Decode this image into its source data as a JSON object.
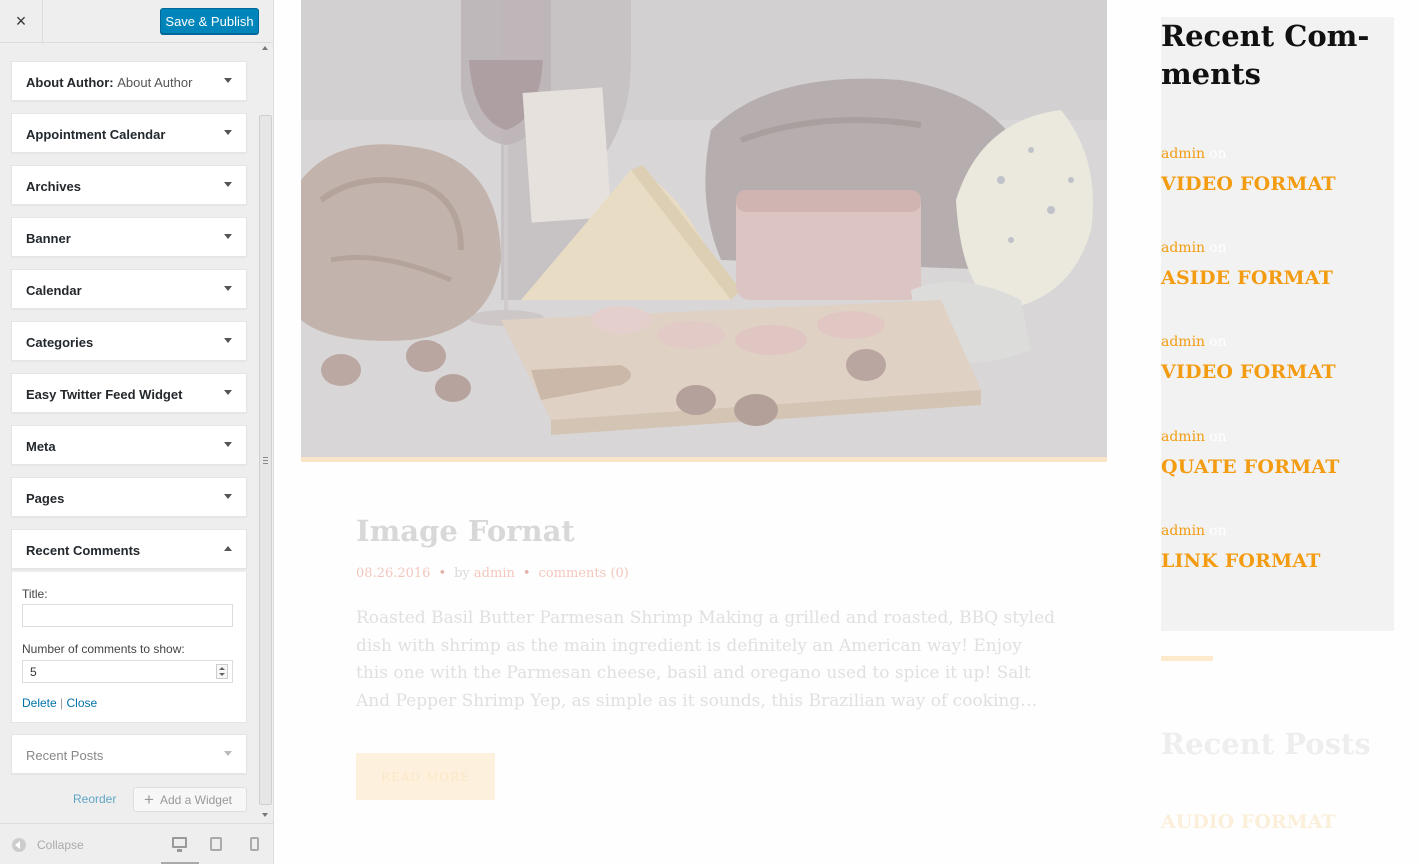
{
  "customizer": {
    "close_icon": "×",
    "save_publish": "Save & Publish",
    "widgets": [
      {
        "label": "About Author:",
        "sublabel": "About Author",
        "expanded": false
      },
      {
        "label": "Appointment Calendar",
        "expanded": false
      },
      {
        "label": "Archives",
        "expanded": false
      },
      {
        "label": "Banner",
        "expanded": false
      },
      {
        "label": "Calendar",
        "expanded": false
      },
      {
        "label": "Categories",
        "expanded": false
      },
      {
        "label": "Easy Twitter Feed Widget",
        "expanded": false
      },
      {
        "label": "Meta",
        "expanded": false
      },
      {
        "label": "Pages",
        "expanded": false
      },
      {
        "label": "Recent Comments",
        "expanded": true
      },
      {
        "label": "Recent Posts",
        "expanded": false
      }
    ],
    "recent_comments_form": {
      "title_label": "Title:",
      "title_value": "",
      "count_label": "Number of comments to show:",
      "count_value": "5",
      "delete_link": "Delete",
      "separator": "|",
      "close_link": "Close"
    },
    "reorder": "Reorder",
    "add_widget": "Add a Widget",
    "collapse": "Collapse",
    "devices": [
      "desktop-icon",
      "tablet-icon",
      "mobile-icon"
    ]
  },
  "preview": {
    "post": {
      "title": "Image Fornat",
      "date": "08.26.2016",
      "by": "by",
      "author": "admin",
      "comments": "comments (0)",
      "excerpt": "Roasted Basil Butter Parmesan Shrimp Making a grilled and roasted, BBQ styled dish with shrimp as the main ingredient is definitely an American way! Enjoy this one with the Parmesan cheese, basil and oregano used to spice it up!   Salt And Pepper Shrimp Yep, as simple as it sounds, this Brazilian way of cooking…",
      "read_more": "READ MORE"
    },
    "recent_comments": {
      "title": "Recent Com-ments",
      "on_word": "on",
      "items": [
        {
          "author": "admin",
          "post": "VIDEO FORMAT"
        },
        {
          "author": "admin",
          "post": "ASIDE FORMAT"
        },
        {
          "author": "admin",
          "post": "VIDEO FORMAT"
        },
        {
          "author": "admin",
          "post": "QUATE FORMAT"
        },
        {
          "author": "admin",
          "post": "LINK FORMAT"
        }
      ]
    },
    "recent_posts": {
      "title": "Recent Posts",
      "first": "AUDIO FORMAT"
    }
  },
  "colors": {
    "primary_button": "#0085ba",
    "link": "#0073aa",
    "accent": "#f39c12"
  }
}
